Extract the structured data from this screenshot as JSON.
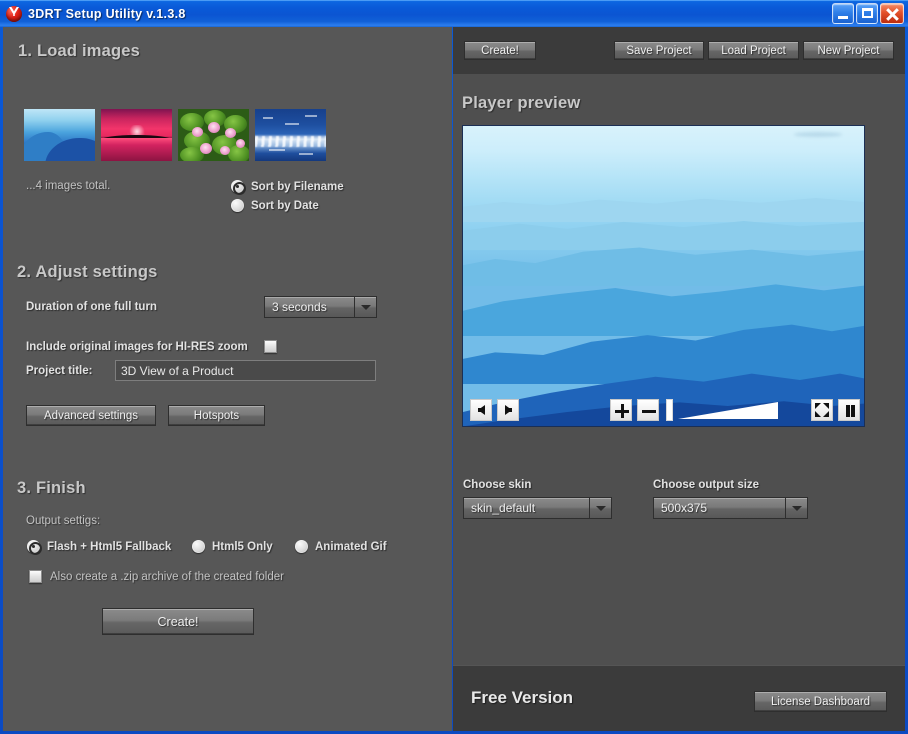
{
  "window": {
    "title": "3DRT Setup Utility v.1.3.8",
    "app_icon": "red-sphere-icon",
    "controls": {
      "minimize": "minimize-icon",
      "maximize": "maximize-icon",
      "close": "close-icon"
    },
    "accent_color": "#0a5ad8",
    "panel_color": "#575757"
  },
  "left_panel": {
    "section1": {
      "heading": "1. Load images",
      "images_total": "...4 images total.",
      "thumbnails": [
        {
          "name": "mountains-thumbnail"
        },
        {
          "name": "sunset-thumbnail"
        },
        {
          "name": "lotus-flowers-thumbnail"
        },
        {
          "name": "ocean-waves-thumbnail"
        }
      ],
      "sort_options": [
        {
          "label": "Sort by Filename",
          "selected": true
        },
        {
          "label": "Sort by Date",
          "selected": false
        }
      ]
    },
    "section2": {
      "heading": "2. Adjust settings",
      "duration_label": "Duration of one full turn",
      "duration_value": "3 seconds",
      "hires_label": "Include original images for HI-RES zoom",
      "hires_checked": false,
      "project_title_label": "Project title:",
      "project_title_value": "3D View of a Product",
      "advanced_button": "Advanced settings",
      "hotspots_button": "Hotspots"
    },
    "section3": {
      "heading": "3. Finish",
      "output_settings_label": "Output settigs:",
      "output_options": [
        {
          "label": "Flash + Html5 Fallback",
          "selected": true
        },
        {
          "label": "Html5 Only",
          "selected": false
        },
        {
          "label": "Animated Gif",
          "selected": false
        }
      ],
      "zip_label": "Also create a .zip archive of the created folder",
      "zip_checked": false,
      "create_button": "Create!"
    }
  },
  "right_panel": {
    "toolbar": {
      "create": "Create!",
      "save_project": "Save Project",
      "load_project": "Load Project",
      "new_project": "New Project"
    },
    "preview": {
      "heading": "Player preview",
      "controls": {
        "prev": "previous-frame-icon",
        "next": "next-frame-icon",
        "zoom_in": "zoom-in-icon",
        "zoom_out": "zoom-out-icon",
        "speed_slider": "speed-slider",
        "fullscreen": "fullscreen-icon",
        "pause": "pause-icon"
      }
    },
    "options": {
      "skin_label": "Choose skin",
      "skin_value": "skin_default",
      "size_label": "Choose output size",
      "size_value": "500x375"
    },
    "footer": {
      "version": "Free Version",
      "license_button": "License Dashboard"
    }
  }
}
